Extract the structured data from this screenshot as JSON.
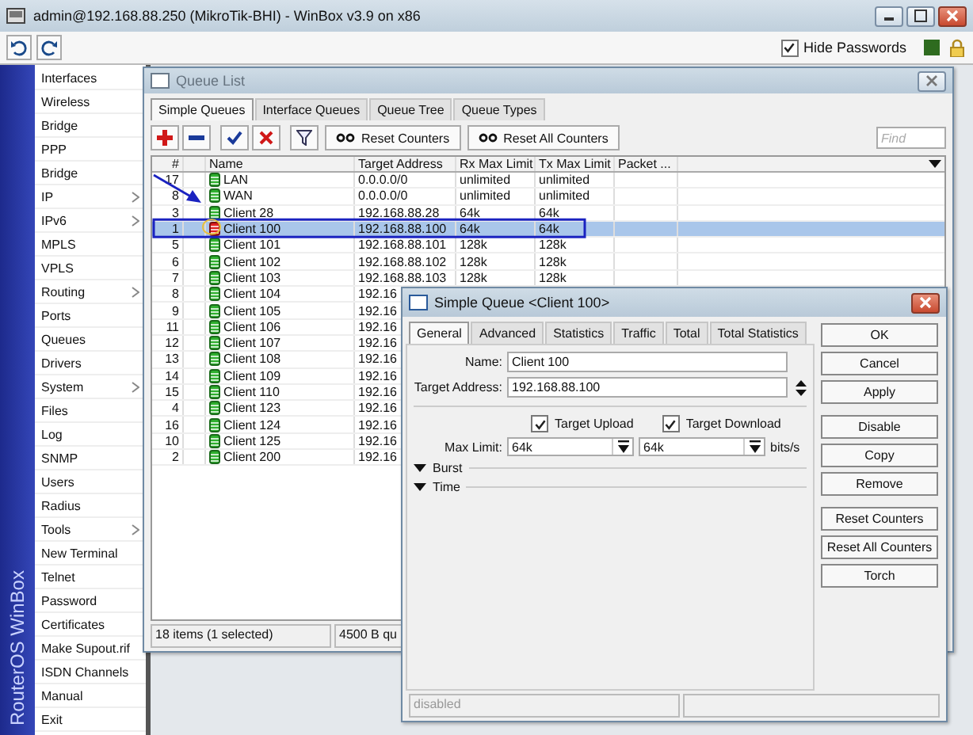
{
  "window": {
    "title": "admin@192.168.88.250 (MikroTik-BHI) - WinBox v3.9 on x86"
  },
  "toolbar": {
    "hide_passwords": {
      "label": "Hide Passwords",
      "checked": true
    }
  },
  "sidebar": {
    "brand": "RouterOS WinBox",
    "items": [
      {
        "label": "Interfaces",
        "submenu": false
      },
      {
        "label": "Wireless",
        "submenu": false
      },
      {
        "label": "Bridge",
        "submenu": false
      },
      {
        "label": "PPP",
        "submenu": false
      },
      {
        "label": "Bridge",
        "submenu": false
      },
      {
        "label": "IP",
        "submenu": true
      },
      {
        "label": "IPv6",
        "submenu": true
      },
      {
        "label": "MPLS",
        "submenu": false
      },
      {
        "label": "VPLS",
        "submenu": false
      },
      {
        "label": "Routing",
        "submenu": true
      },
      {
        "label": "Ports",
        "submenu": false
      },
      {
        "label": "Queues",
        "submenu": false
      },
      {
        "label": "Drivers",
        "submenu": false
      },
      {
        "label": "System",
        "submenu": true
      },
      {
        "label": "Files",
        "submenu": false
      },
      {
        "label": "Log",
        "submenu": false
      },
      {
        "label": "SNMP",
        "submenu": false
      },
      {
        "label": "Users",
        "submenu": false
      },
      {
        "label": "Radius",
        "submenu": false
      },
      {
        "label": "Tools",
        "submenu": true
      },
      {
        "label": "New Terminal",
        "submenu": false
      },
      {
        "label": "Telnet",
        "submenu": false
      },
      {
        "label": "Password",
        "submenu": false
      },
      {
        "label": "Certificates",
        "submenu": false
      },
      {
        "label": "Make Supout.rif",
        "submenu": false
      },
      {
        "label": "ISDN Channels",
        "submenu": false
      },
      {
        "label": "Manual",
        "submenu": false
      },
      {
        "label": "Exit",
        "submenu": false
      }
    ]
  },
  "queue_list": {
    "title": "Queue List",
    "tabs": [
      {
        "label": "Simple Queues",
        "selected": true
      },
      {
        "label": "Interface Queues",
        "selected": false
      },
      {
        "label": "Queue Tree",
        "selected": false
      },
      {
        "label": "Queue Types",
        "selected": false
      }
    ],
    "buttons": [
      "Reset Counters",
      "Reset All Counters"
    ],
    "search": {
      "placeholder": "Find"
    },
    "columns": [
      "#",
      "Name",
      "Target Address",
      "Rx Max Limit",
      "Tx Max Limit",
      "Packet ..."
    ],
    "rows": [
      {
        "num": "17",
        "name": "LAN",
        "target": "0.0.0.0/0",
        "rx": "unlimited",
        "tx": "unlimited",
        "disabled": false,
        "selected": false
      },
      {
        "num": "8",
        "name": "WAN",
        "target": "0.0.0.0/0",
        "rx": "unlimited",
        "tx": "unlimited",
        "disabled": false,
        "selected": false
      },
      {
        "num": "3",
        "name": "Client 28",
        "target": "192.168.88.28",
        "rx": "64k",
        "tx": "64k",
        "disabled": false,
        "selected": false
      },
      {
        "num": "1",
        "name": "Client 100",
        "target": "192.168.88.100",
        "rx": "64k",
        "tx": "64k",
        "disabled": true,
        "selected": true
      },
      {
        "num": "5",
        "name": "Client 101",
        "target": "192.168.88.101",
        "rx": "128k",
        "tx": "128k",
        "disabled": false,
        "selected": false
      },
      {
        "num": "6",
        "name": "Client 102",
        "target": "192.168.88.102",
        "rx": "128k",
        "tx": "128k",
        "disabled": false,
        "selected": false
      },
      {
        "num": "7",
        "name": "Client 103",
        "target": "192.168.88.103",
        "rx": "128k",
        "tx": "128k",
        "disabled": false,
        "selected": false
      },
      {
        "num": "8",
        "name": "Client 104",
        "target": "192.16",
        "disabled": false,
        "selected": false
      },
      {
        "num": "9",
        "name": "Client 105",
        "target": "192.16",
        "disabled": false,
        "selected": false
      },
      {
        "num": "11",
        "name": "Client 106",
        "target": "192.16",
        "disabled": false,
        "selected": false
      },
      {
        "num": "12",
        "name": "Client 107",
        "target": "192.16",
        "disabled": false,
        "selected": false
      },
      {
        "num": "13",
        "name": "Client 108",
        "target": "192.16",
        "disabled": false,
        "selected": false
      },
      {
        "num": "14",
        "name": "Client 109",
        "target": "192.16",
        "disabled": false,
        "selected": false
      },
      {
        "num": "15",
        "name": "Client 110",
        "target": "192.16",
        "disabled": false,
        "selected": false
      },
      {
        "num": "4",
        "name": "Client 123",
        "target": "192.16",
        "disabled": false,
        "selected": false
      },
      {
        "num": "16",
        "name": "Client 124",
        "target": "192.16",
        "disabled": false,
        "selected": false
      },
      {
        "num": "10",
        "name": "Client 125",
        "target": "192.16",
        "disabled": false,
        "selected": false
      },
      {
        "num": "2",
        "name": "Client 200",
        "target": "192.16",
        "disabled": false,
        "selected": false
      }
    ],
    "status": [
      "18 items (1 selected)",
      "4500 B qu"
    ]
  },
  "dialog": {
    "title": "Simple Queue <Client 100>",
    "tabs": [
      {
        "label": "General",
        "selected": true
      },
      {
        "label": "Advanced",
        "selected": false
      },
      {
        "label": "Statistics",
        "selected": false
      },
      {
        "label": "Traffic",
        "selected": false
      },
      {
        "label": "Total",
        "selected": false
      },
      {
        "label": "Total Statistics",
        "selected": false
      }
    ],
    "name": {
      "label": "Name:",
      "value": "Client 100"
    },
    "target_address": {
      "label": "Target Address:",
      "value": "192.168.88.100"
    },
    "checkboxes": [
      {
        "label": "Target Upload",
        "checked": true
      },
      {
        "label": "Target Download",
        "checked": true
      }
    ],
    "max_limit": {
      "label": "Max Limit:",
      "upload": "64k",
      "download": "64k",
      "unit": "bits/s"
    },
    "sections": [
      {
        "label": "Burst",
        "expanded": false
      },
      {
        "label": "Time",
        "expanded": false
      }
    ],
    "buttons": [
      "OK",
      "Cancel",
      "Apply",
      "Disable",
      "Copy",
      "Remove",
      "Reset Counters",
      "Reset All Counters",
      "Torch"
    ],
    "status": "disabled"
  }
}
